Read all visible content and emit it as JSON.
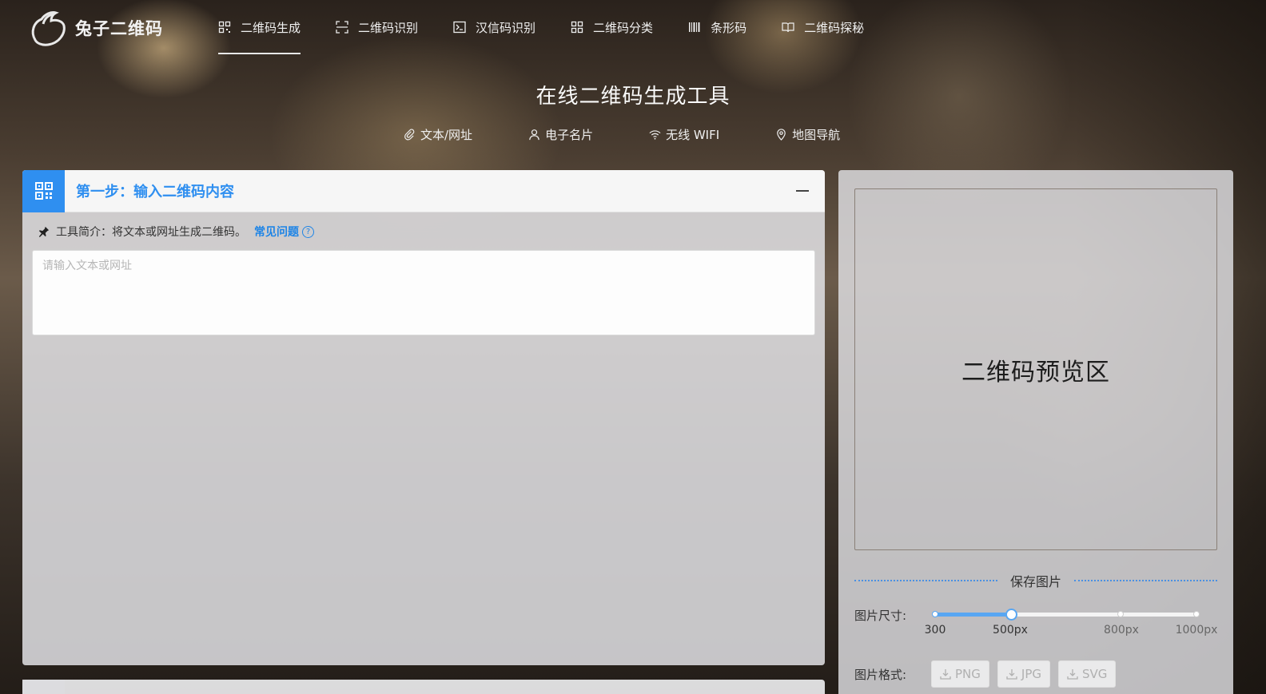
{
  "app": {
    "logo_text": "兔子二维码"
  },
  "nav": {
    "items": [
      {
        "label": "二维码生成",
        "icon": "qrcode-icon",
        "active": true
      },
      {
        "label": "二维码识别",
        "icon": "scan-icon"
      },
      {
        "label": "汉信码识别",
        "icon": "terminal-icon"
      },
      {
        "label": "二维码分类",
        "icon": "grid-icon"
      },
      {
        "label": "条形码",
        "icon": "barcode-icon"
      },
      {
        "label": "二维码探秘",
        "icon": "book-icon"
      }
    ]
  },
  "page": {
    "title": "在线二维码生成工具"
  },
  "subtabs": [
    {
      "label": "文本/网址",
      "icon": "link-icon"
    },
    {
      "label": "电子名片",
      "icon": "user-icon"
    },
    {
      "label": "无线 WIFI",
      "icon": "wifi-icon"
    },
    {
      "label": "地图导航",
      "icon": "map-pin-icon"
    }
  ],
  "step1": {
    "title": "第一步：输入二维码内容",
    "intro_label": "工具简介：将文本或网址生成二维码。",
    "faq_label": "常见问题",
    "input": {
      "value": "",
      "placeholder": "请输入文本或网址"
    }
  },
  "preview": {
    "text": "二维码预览区"
  },
  "save": {
    "title": "保存图片",
    "size_label": "图片尺寸:",
    "size_ticks": [
      "300",
      "500px",
      "800px",
      "1000px"
    ],
    "size_selected": "500px",
    "format_label": "图片格式:",
    "formats": [
      "PNG",
      "JPG",
      "SVG"
    ]
  },
  "colors": {
    "accent": "#2f8ff0",
    "slider": "#58a6f2"
  }
}
